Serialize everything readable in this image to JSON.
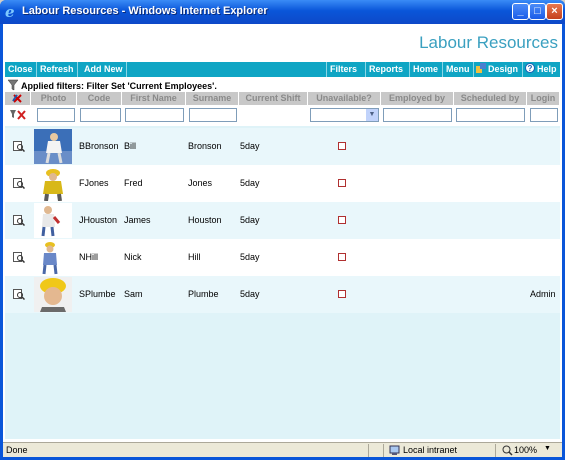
{
  "window": {
    "title": "Labour Resources - Windows Internet Explorer"
  },
  "app": {
    "title": "Labour Resources"
  },
  "toolbar": {
    "left": [
      "Close",
      "Refresh",
      "Add New"
    ],
    "right": [
      "Filters",
      "Reports",
      "Home",
      "Menu",
      "Design",
      "Help"
    ]
  },
  "filter_text": "Applied filters: Filter Set 'Current Employees'.",
  "columns": [
    "Photo",
    "Code",
    "First Name",
    "Surname",
    "Current Shift",
    "Unavailable?",
    "Employed by",
    "Scheduled by",
    "Login"
  ],
  "rows": [
    {
      "code": "BBronson",
      "first": "Bill",
      "surname": "Bronson",
      "shift": "5day",
      "login": ""
    },
    {
      "code": "FJones",
      "first": "Fred",
      "surname": "Jones",
      "shift": "5day",
      "login": ""
    },
    {
      "code": "JHouston",
      "first": "James",
      "surname": "Houston",
      "shift": "5day",
      "login": ""
    },
    {
      "code": "NHill",
      "first": "Nick",
      "surname": "Hill",
      "shift": "5day",
      "login": ""
    },
    {
      "code": "SPlumbe",
      "first": "Sam",
      "surname": "Plumbe",
      "shift": "5day",
      "login": "Admin"
    }
  ],
  "status": {
    "left": "Done",
    "zone": "Local intranet",
    "zoom": "100%"
  },
  "colors": {
    "accent": "#0fa5c4",
    "title": "#3aa0c0",
    "row_alt": "#e9f7fb"
  }
}
